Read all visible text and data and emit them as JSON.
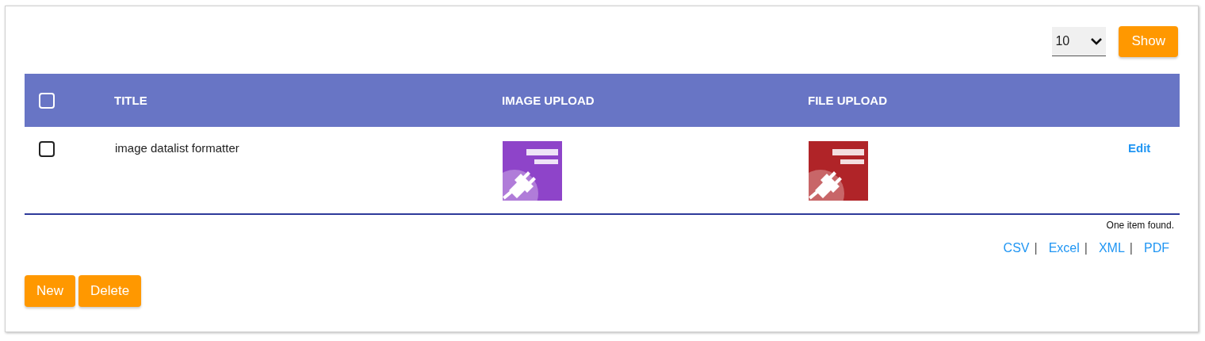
{
  "page_size": {
    "value": "10",
    "button": "Show"
  },
  "table": {
    "select_all": {
      "checked": false
    },
    "columns": [
      "TITLE",
      "IMAGE UPLOAD",
      "FILE UPLOAD"
    ],
    "rows": [
      {
        "checked": false,
        "title": "image datalist formatter",
        "action": "Edit"
      }
    ]
  },
  "result_count": "One item found.",
  "exports": [
    {
      "label": "CSV",
      "separator": "|"
    },
    {
      "label": "Excel",
      "separator": "|"
    },
    {
      "label": "XML",
      "separator": "|"
    },
    {
      "label": "PDF"
    }
  ],
  "buttons": [
    "New",
    "Delete"
  ]
}
